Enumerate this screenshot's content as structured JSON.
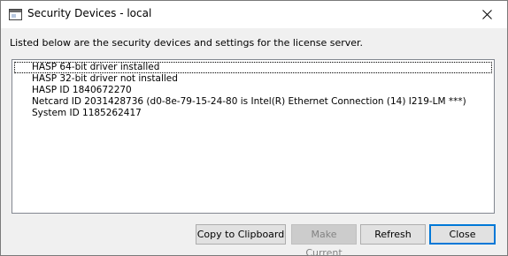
{
  "window": {
    "title": "Security Devices - local",
    "close_glyph": "close-icon"
  },
  "description": "Listed below are the security devices and settings for the license server.",
  "devices": [
    "HASP 64-bit driver installed",
    "HASP 32-bit driver not installed",
    "HASP ID 1840672270",
    "Netcard ID 2031428736 (d0-8e-79-15-24-80 is Intel(R) Ethernet Connection (14) I219-LM ***)",
    "System ID 1185262417"
  ],
  "buttons": {
    "copy": "Copy to Clipboard",
    "make_current": "Make Current",
    "refresh": "Refresh",
    "close": "Close"
  },
  "colors": {
    "focus_accent": "#0078d7",
    "disabled_text": "#838383"
  }
}
